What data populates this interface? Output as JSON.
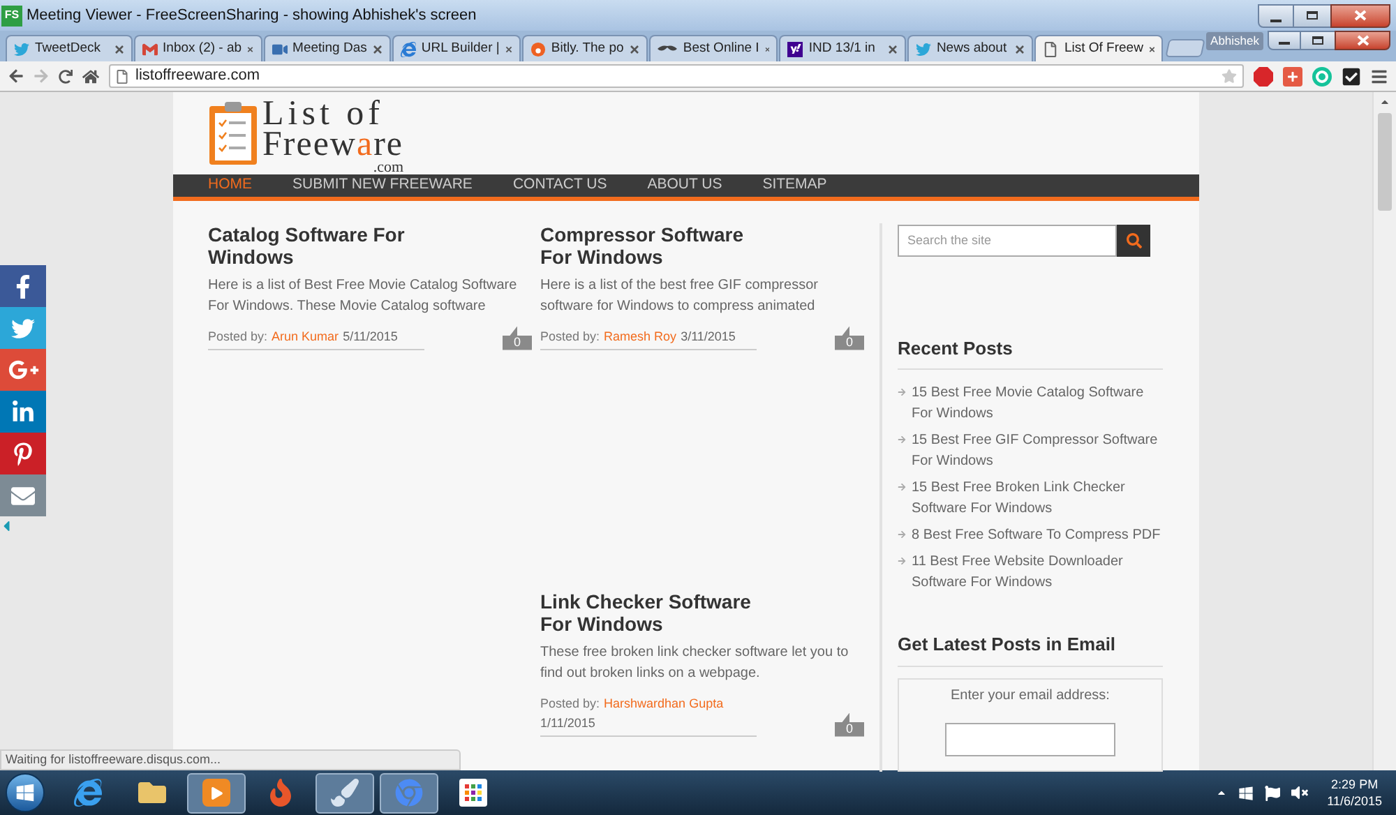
{
  "window": {
    "badge": "FS",
    "title": "Meeting Viewer - FreeScreenSharing - showing Abhishek's screen"
  },
  "browser": {
    "tabs": [
      {
        "label": "TweetDeck",
        "kind": "twitter",
        "selected": false
      },
      {
        "label": "Inbox (2) - ab",
        "kind": "mail",
        "selected": false
      },
      {
        "label": "Meeting Das",
        "kind": "meeting",
        "selected": false
      },
      {
        "label": "URL Builder |",
        "kind": "ie",
        "selected": false
      },
      {
        "label": "Bitly. The po",
        "kind": "bitly",
        "selected": false
      },
      {
        "label": "Best Online I",
        "kind": "mustache",
        "selected": false
      },
      {
        "label": "IND 13/1 in",
        "kind": "yahoo",
        "selected": false
      },
      {
        "label": "News about",
        "kind": "twitter",
        "selected": false
      },
      {
        "label": "List Of Freew",
        "kind": "page",
        "selected": true
      }
    ],
    "profile": "Abhishek",
    "url": "listoffreeware.com"
  },
  "site": {
    "logo": {
      "top": "List of",
      "bottom": [
        "Freew",
        "a",
        "re"
      ],
      "domain": ".com"
    },
    "nav": [
      {
        "label": "HOME",
        "selected": true
      },
      {
        "label": "SUBMIT NEW FREEWARE",
        "selected": false
      },
      {
        "label": "CONTACT US",
        "selected": false
      },
      {
        "label": "ABOUT US",
        "selected": false
      },
      {
        "label": "SITEMAP",
        "selected": false
      }
    ],
    "columns": [
      [
        {
          "title": "Catalog Software For Windows",
          "excerpt": "Here is a list of Best Free Movie Catalog Software For Windows. These Movie Catalog software",
          "posted_by": "Posted by:",
          "author": "Arun Kumar",
          "date": "5/11/2015",
          "comments": "0"
        }
      ],
      [
        {
          "title": "Compressor Software For Windows",
          "excerpt": "Here is a list of the best free GIF compressor software for Windows to compress animated",
          "posted_by": "Posted by:",
          "author": "Ramesh Roy",
          "date": "3/11/2015",
          "comments": "0"
        },
        {
          "title": "Link Checker Software For Windows",
          "excerpt": "These free broken link checker software let you to find out broken links on a webpage.",
          "posted_by": "Posted by:",
          "author": "Harshwardhan Gupta",
          "date": "1/11/2015",
          "comments": "0"
        }
      ]
    ],
    "sidebar": {
      "search": {
        "placeholder": "Search the site"
      },
      "recent_posts": {
        "heading": "Recent Posts",
        "items": [
          "15 Best Free Movie Catalog Software For Windows",
          "15 Best Free GIF Compressor Software For Windows",
          "15 Best Free Broken Link Checker Software For Windows",
          "8 Best Free Software To Compress PDF",
          "11 Best Free Website Downloader Software For Windows"
        ]
      },
      "email": {
        "heading": "Get Latest Posts in Email",
        "label": "Enter your email address:"
      }
    },
    "share": [
      {
        "kind": "facebook",
        "color": "#3b5998"
      },
      {
        "kind": "twitter",
        "color": "#2ca7d8"
      },
      {
        "kind": "googleplus",
        "color": "#dd4b39"
      },
      {
        "kind": "linkedin",
        "color": "#0077b5"
      },
      {
        "kind": "pinterest",
        "color": "#cb2027"
      },
      {
        "kind": "email",
        "color": "#7d8b95"
      }
    ]
  },
  "status": "Waiting for listoffreeware.disqus.com...",
  "taskbar": {
    "apps": [
      {
        "kind": "ie",
        "active": false
      },
      {
        "kind": "folder",
        "active": false
      },
      {
        "kind": "media",
        "active": true
      },
      {
        "kind": "flame",
        "active": false
      },
      {
        "kind": "paint",
        "active": true
      },
      {
        "kind": "chrome",
        "active": true
      },
      {
        "kind": "grid",
        "active": false
      }
    ],
    "time": "2:29 PM",
    "date": "11/6/2015"
  }
}
